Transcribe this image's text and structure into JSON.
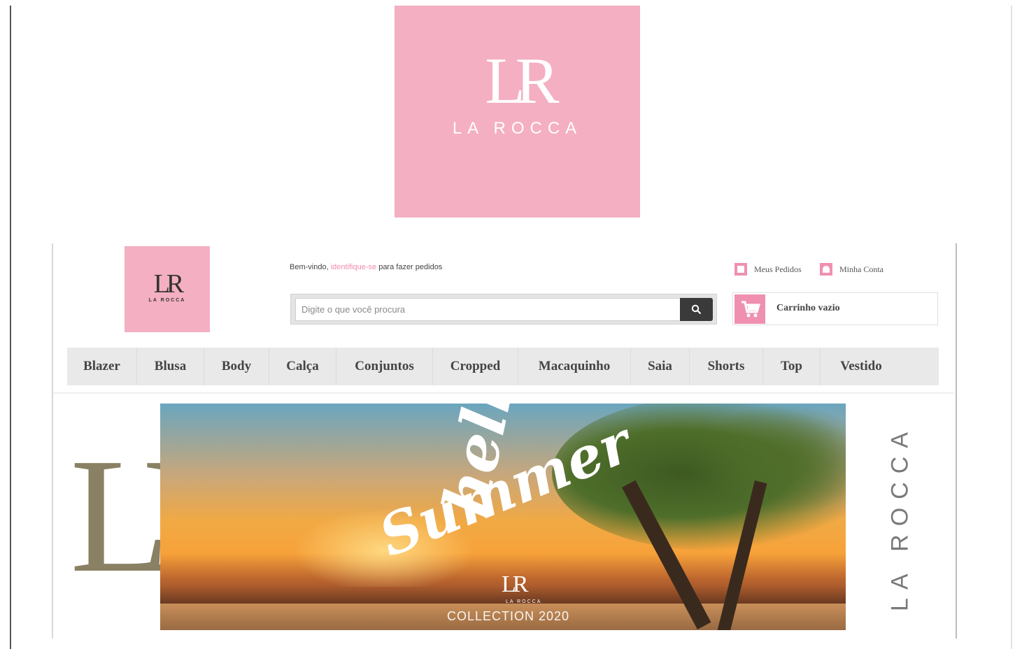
{
  "top_logo": {
    "monogram": "LR",
    "brand": "LA ROCCA"
  },
  "header": {
    "logo": {
      "monogram": "LR",
      "brand": "LA ROCCA"
    },
    "welcome": {
      "prefix": "Bem-vindo, ",
      "link": "identifique-se",
      "suffix": " para fazer pedidos"
    },
    "search": {
      "placeholder": "Digite o que você procura"
    },
    "account_links": [
      {
        "label": "Meus Pedidos",
        "icon": "orders-icon"
      },
      {
        "label": "Minha Conta",
        "icon": "account-icon"
      }
    ],
    "cart": {
      "label": "Carrinho vazio",
      "icon": "cart-icon"
    }
  },
  "nav": {
    "items": [
      {
        "label": "Blazer"
      },
      {
        "label": "Blusa"
      },
      {
        "label": "Body"
      },
      {
        "label": "Calça"
      },
      {
        "label": "Conjuntos"
      },
      {
        "label": "Cropped"
      },
      {
        "label": "Macaquinho"
      },
      {
        "label": "Saia"
      },
      {
        "label": "Shorts"
      },
      {
        "label": "Top"
      },
      {
        "label": "Vestido"
      }
    ]
  },
  "banner": {
    "monogram_left": "LR",
    "headline_1": "hello",
    "headline_2": "Summer",
    "mini_monogram": "LR",
    "mini_brand": "LA ROCCA",
    "collection": "COLLECTION 2020",
    "vertical_brand": "LA ROCCA"
  },
  "colors": {
    "brand_pink": "#f4afc2",
    "accent_pink": "#f090b0",
    "nav_bg": "#e9e9e9",
    "search_button": "#3a3a3a"
  }
}
